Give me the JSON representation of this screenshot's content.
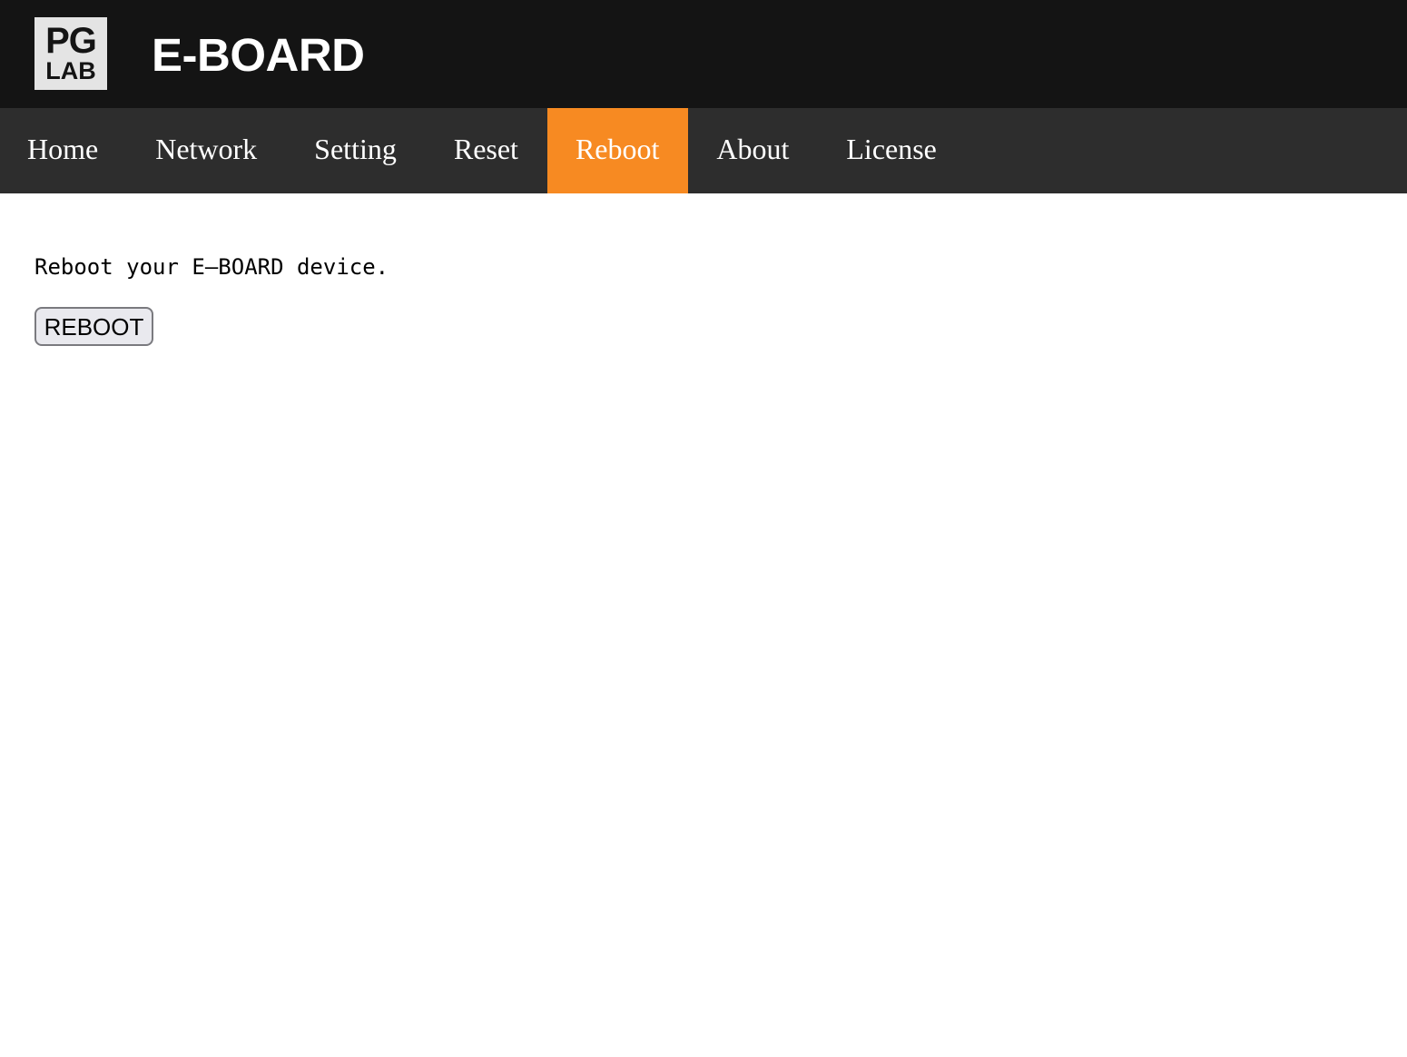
{
  "header": {
    "logo": {
      "top": "PG",
      "bottom": "LAB"
    },
    "title": "E-BOARD"
  },
  "nav": {
    "items": [
      {
        "label": "Home"
      },
      {
        "label": "Network"
      },
      {
        "label": "Setting"
      },
      {
        "label": "Reset"
      },
      {
        "label": "Reboot",
        "active": true
      },
      {
        "label": "About"
      },
      {
        "label": "License"
      }
    ]
  },
  "main": {
    "description": "Reboot your E–BOARD device.",
    "reboot_button_label": "REBOOT"
  },
  "colors": {
    "header_bg": "#141414",
    "nav_bg": "#2d2d2d",
    "active_accent": "#f78a22"
  }
}
